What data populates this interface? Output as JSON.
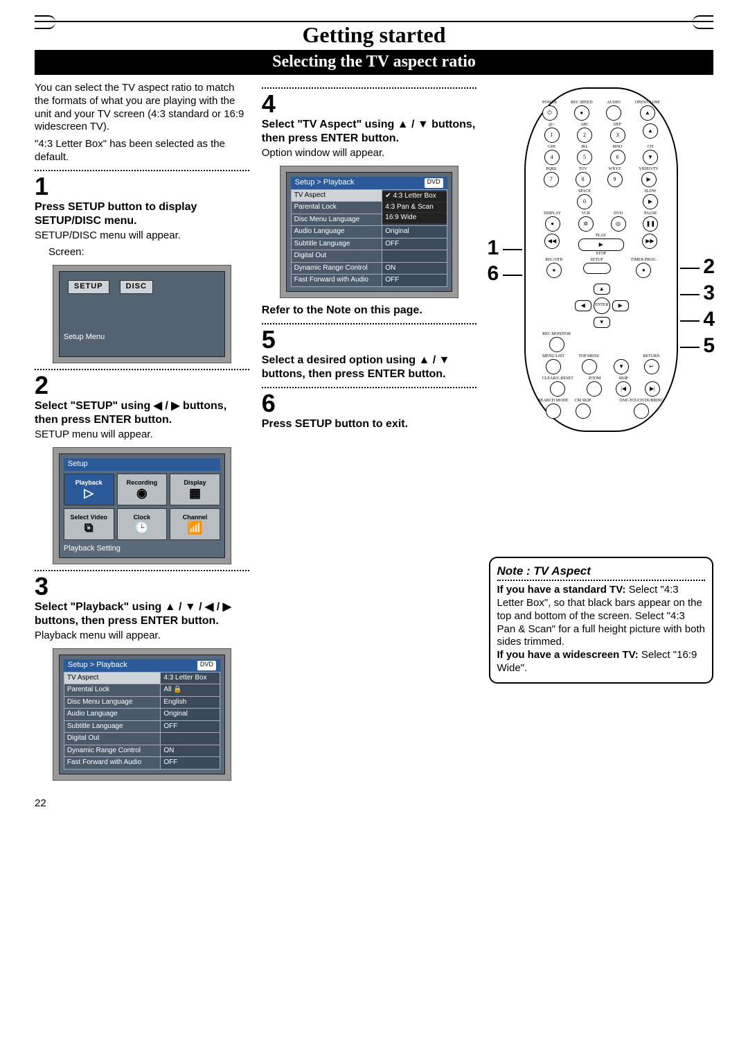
{
  "page_number": "22",
  "chapter_title": "Getting started",
  "section_title": "Selecting the TV aspect ratio",
  "intro": {
    "p1": "You can select the TV aspect ratio to match the formats of what you are playing with the unit and your TV screen (4:3 standard or 16:9 widescreen TV).",
    "p2": "\"4:3 Letter Box\" has been select­ed as the default."
  },
  "steps": {
    "s1": {
      "num": "1",
      "head": "Press SETUP button to dis­play SETUP/DISC menu.",
      "body": "SETUP/DISC menu will appear.",
      "screen_label": "Screen:"
    },
    "s2": {
      "num": "2",
      "head": "Select \"SETUP\" using ◀ / ▶ buttons, then press ENTER button.",
      "body": "SETUP menu will appear."
    },
    "s3": {
      "num": "3",
      "head": "Select \"Playback\" using ▲ / ▼ / ◀ / ▶ buttons, then press ENTER button.",
      "body": "Playback menu will appear."
    },
    "s4": {
      "num": "4",
      "head": "Select \"TV Aspect\" using ▲ / ▼ buttons, then press ENTER button.",
      "body": "Option window will appear."
    },
    "s4b": {
      "head": "Refer to the Note on this page."
    },
    "s5": {
      "num": "5",
      "head": "Select a desired option using ▲ / ▼ buttons, then press ENTER button."
    },
    "s6": {
      "num": "6",
      "head": "Press SETUP button to exit."
    }
  },
  "osd1": {
    "setup_label": "SETUP",
    "disc_label": "DISC",
    "caption": "Setup Menu"
  },
  "osd2": {
    "header": "Setup",
    "cells": [
      "Playback",
      "Recording",
      "Display",
      "Select Video",
      "Clock",
      "Channel"
    ],
    "caption": "Playback Setting"
  },
  "osd3": {
    "breadcrumb": "Setup > Playback",
    "badge": "DVD",
    "rows": [
      [
        "TV Aspect",
        "4:3 Letter Box"
      ],
      [
        "Parental Lock",
        "All  🔒"
      ],
      [
        "Disc Menu Language",
        "English"
      ],
      [
        "Audio Language",
        "Original"
      ],
      [
        "Subtitle Language",
        "OFF"
      ],
      [
        "Digital Out",
        ""
      ],
      [
        "Dynamic Range Control",
        "ON"
      ],
      [
        "Fast Forward with Audio",
        "OFF"
      ]
    ]
  },
  "osd4": {
    "breadcrumb": "Setup > Playback",
    "badge": "DVD",
    "rows": [
      [
        "TV Aspect",
        ""
      ],
      [
        "Parental Lock",
        ""
      ],
      [
        "Disc Menu Language",
        ""
      ],
      [
        "Audio Language",
        "Original"
      ],
      [
        "Subtitle Language",
        "OFF"
      ],
      [
        "Digital Out",
        ""
      ],
      [
        "Dynamic Range Control",
        "ON"
      ],
      [
        "Fast Forward with Audio",
        "OFF"
      ]
    ],
    "options": [
      "4:3 Letter Box",
      "4:3 Pan & Scan",
      "16:9 Wide"
    ]
  },
  "note": {
    "title": "Note : TV Aspect",
    "h1": "If you have a standard TV:",
    "p1": "Select \"4:3 Letter Box\", so that black bars appear on the top and bottom of the screen. Select \"4:3 Pan & Scan\" for a full height picture with both sides trimmed.",
    "h2": "If you have a widescreen TV:",
    "p2": "Select \"16:9 Wide\"."
  },
  "remote": {
    "top_row": [
      "POWER",
      "REC SPEED",
      "AUDIO",
      "OPEN/CLOSE"
    ],
    "num_labels": [
      "@/:",
      "ABC",
      "DEF",
      "",
      "GHI",
      "JKL",
      "MNO",
      "CH",
      "PQRS",
      "TUV",
      "WXYZ",
      "VIDEO/TV",
      "",
      "SPACE",
      "",
      "SLOW"
    ],
    "numbers": [
      "1",
      "2",
      "3",
      "▲",
      "4",
      "5",
      "6",
      "▼",
      "7",
      "8",
      "9",
      "▶",
      "",
      "0",
      "",
      "▶"
    ],
    "mid_row": [
      "DISPLAY",
      "VCR",
      "DVD",
      "PAUSE"
    ],
    "play": "PLAY",
    "stop": "STOP",
    "rev": "◀◀",
    "fwd": "▶▶",
    "rec_row": [
      "REC/OTR",
      "SETUP",
      "",
      "TIMER PROG."
    ],
    "dpad_center": "ENTER",
    "bottom": [
      "REC MONITOR",
      "",
      "",
      "",
      "MENU/LIST",
      "TOP MENU",
      "▼",
      "RETURN",
      "CLEAR/C.RESET",
      "ZOOM",
      "◀◀",
      "SKIP ▶▶",
      "SEARCH MODE",
      "CM SKIP",
      "",
      "ONE-TOUCH DUBBING"
    ]
  },
  "callouts": {
    "c1": "1",
    "c6": "6",
    "c2": "2",
    "c3": "3",
    "c4": "4",
    "c5": "5"
  }
}
